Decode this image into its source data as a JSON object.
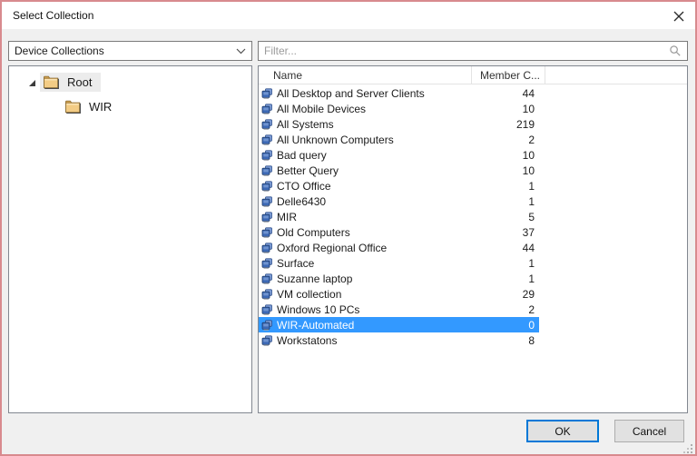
{
  "dialog": {
    "title": "Select Collection"
  },
  "toolbar": {
    "collection_type_value": "Device Collections",
    "filter_placeholder": "Filter..."
  },
  "tree": {
    "items": [
      {
        "label": "Root",
        "level": 1,
        "expanded": true,
        "selected": true
      },
      {
        "label": "WIR",
        "level": 2,
        "expanded": false,
        "selected": false
      }
    ]
  },
  "list": {
    "columns": [
      {
        "label": "Name"
      },
      {
        "label": "Member C..."
      }
    ],
    "rows": [
      {
        "name": "All Desktop and Server Clients",
        "count": "44",
        "selected": false
      },
      {
        "name": "All Mobile Devices",
        "count": "10",
        "selected": false
      },
      {
        "name": "All Systems",
        "count": "219",
        "selected": false
      },
      {
        "name": "All Unknown Computers",
        "count": "2",
        "selected": false
      },
      {
        "name": "Bad query",
        "count": "10",
        "selected": false
      },
      {
        "name": "Better Query",
        "count": "10",
        "selected": false
      },
      {
        "name": "CTO Office",
        "count": "1",
        "selected": false
      },
      {
        "name": "Delle6430",
        "count": "1",
        "selected": false
      },
      {
        "name": "MIR",
        "count": "5",
        "selected": false
      },
      {
        "name": "Old Computers",
        "count": "37",
        "selected": false
      },
      {
        "name": "Oxford Regional Office",
        "count": "44",
        "selected": false
      },
      {
        "name": "Surface",
        "count": "1",
        "selected": false
      },
      {
        "name": "Suzanne laptop",
        "count": "1",
        "selected": false
      },
      {
        "name": "VM collection",
        "count": "29",
        "selected": false
      },
      {
        "name": "Windows 10 PCs",
        "count": "2",
        "selected": false
      },
      {
        "name": "WIR-Automated",
        "count": "0",
        "selected": true
      },
      {
        "name": "Workstatons",
        "count": "8",
        "selected": false
      }
    ]
  },
  "footer": {
    "ok_label": "OK",
    "cancel_label": "Cancel"
  },
  "colors": {
    "selection": "#3399ff",
    "dialog_border": "#d88a8e",
    "focus_border": "#0078d7"
  }
}
